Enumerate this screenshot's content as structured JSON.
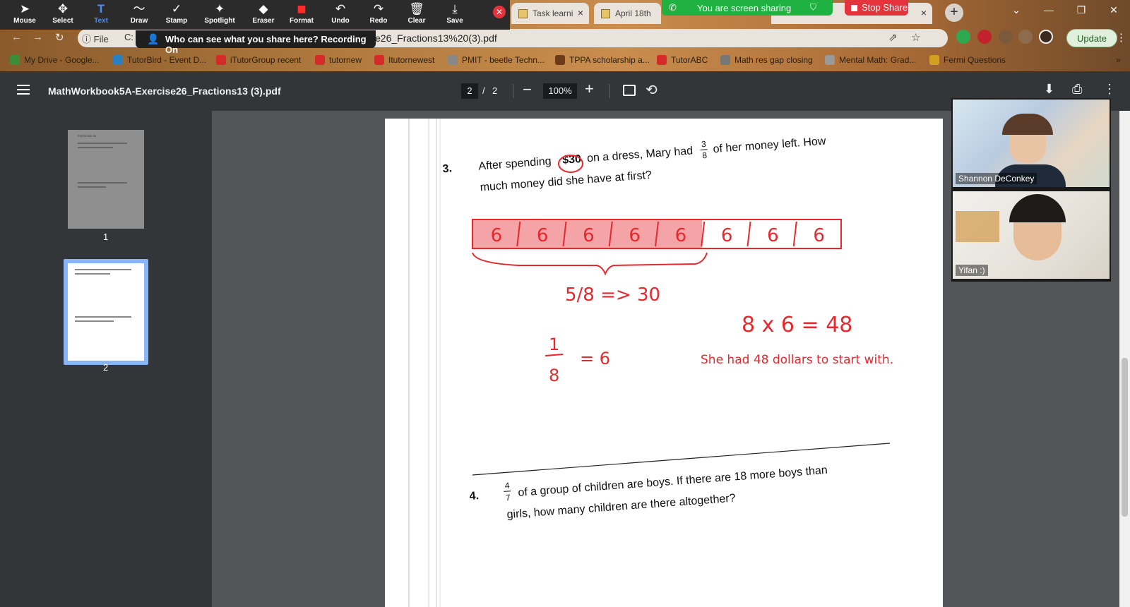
{
  "zoom_toolbar": {
    "tools": [
      {
        "label": "Mouse",
        "icon": "cursor-arrow-icon"
      },
      {
        "label": "Select",
        "icon": "move-arrows-icon"
      },
      {
        "label": "Text",
        "icon": "text-t-icon"
      },
      {
        "label": "Draw",
        "icon": "squiggle-icon"
      },
      {
        "label": "Stamp",
        "icon": "checkmark-icon"
      },
      {
        "label": "Spotlight",
        "icon": "magic-wand-icon"
      },
      {
        "label": "Eraser",
        "icon": "eraser-icon"
      },
      {
        "label": "Format",
        "icon": "color-square-icon"
      },
      {
        "label": "Undo",
        "icon": "undo-icon"
      },
      {
        "label": "Redo",
        "icon": "redo-icon"
      },
      {
        "label": "Clear",
        "icon": "trash-icon"
      },
      {
        "label": "Save",
        "icon": "download-icon"
      }
    ],
    "active_tool": "Text",
    "sharing_banner": "You are screen sharing",
    "stop_share": "Stop Share",
    "recording_tip": "Who can see what you share here? Recording On"
  },
  "browser": {
    "tabs": [
      {
        "title": "Task learni"
      },
      {
        "title": "April 18th"
      }
    ],
    "omnibox_scheme": "File",
    "omnibox_url_fragment": "e26_Fractions13%20(3).pdf",
    "omnibox_extra": "C:",
    "update_button": "Update",
    "bookmarks": [
      "My Drive - Google...",
      "TutorBird - Event D...",
      "iTutorGroup recent",
      "tutornew",
      "Itutornewest",
      "PMIT - beetle Techn...",
      "TPPA scholarship a...",
      "TutorABC",
      "Math res gap closing",
      "Mental Math: Grad...",
      "Fermi Questions"
    ]
  },
  "pdf_viewer": {
    "title": "MathWorkbook5A-Exercise26_Fractions13 (3).pdf",
    "current_page": "2",
    "page_sep": "/",
    "total_pages": "2",
    "zoom": "100%",
    "thumbnails": [
      {
        "label": "1"
      },
      {
        "label": "2"
      }
    ],
    "thumb1_heading": "EXERCISE 26"
  },
  "worksheet": {
    "q3_number": "3.",
    "q3_line1_before": "After spending",
    "q3_amount": "$30",
    "q3_line1_after": "on a dress, Mary had",
    "q3_frac_num": "3",
    "q3_frac_den": "8",
    "q3_line1_end": "of her money left. How",
    "q3_line2": "much money did she have at first?",
    "q4_number": "4.",
    "q4_frac_num": "4",
    "q4_frac_den": "7",
    "q4_line1": "of a group of children are boys. If there are 18 more boys than",
    "q4_line2": "girls, how many children are there altogether?"
  },
  "annotations": {
    "bar_labels": [
      "6",
      "6",
      "6",
      "6",
      "6",
      "6",
      "6",
      "6"
    ],
    "shaded_parts": 5,
    "total_parts": 8,
    "brace_note": "5/8 => 30",
    "unit_note_num": "1",
    "unit_note_den": "8",
    "unit_note_value": "= 6",
    "product_note": "8 x 6 = 48",
    "answer_text": "She had 48 dollars to start with.",
    "ink_color": "#e8282d",
    "fill_color": "#f4a3a6"
  },
  "participants": [
    {
      "name": "Shannon DeConkey"
    },
    {
      "name": "Yifan :)"
    }
  ]
}
